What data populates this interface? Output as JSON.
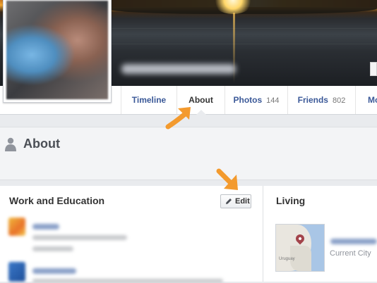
{
  "tabs": [
    {
      "label": "Timeline",
      "count": ""
    },
    {
      "label": "About",
      "count": ""
    },
    {
      "label": "Photos",
      "count": "144"
    },
    {
      "label": "Friends",
      "count": "802"
    },
    {
      "label": "Mo",
      "count": ""
    }
  ],
  "active_tab": "About",
  "about": {
    "title": "About"
  },
  "work_education": {
    "title": "Work and Education",
    "edit_label": "Edit"
  },
  "living": {
    "title": "Living",
    "current_city_label": "Current City",
    "map_text": "Uruguay"
  },
  "colors": {
    "link": "#3b5998",
    "annotation_arrow": "#f39a2e"
  }
}
